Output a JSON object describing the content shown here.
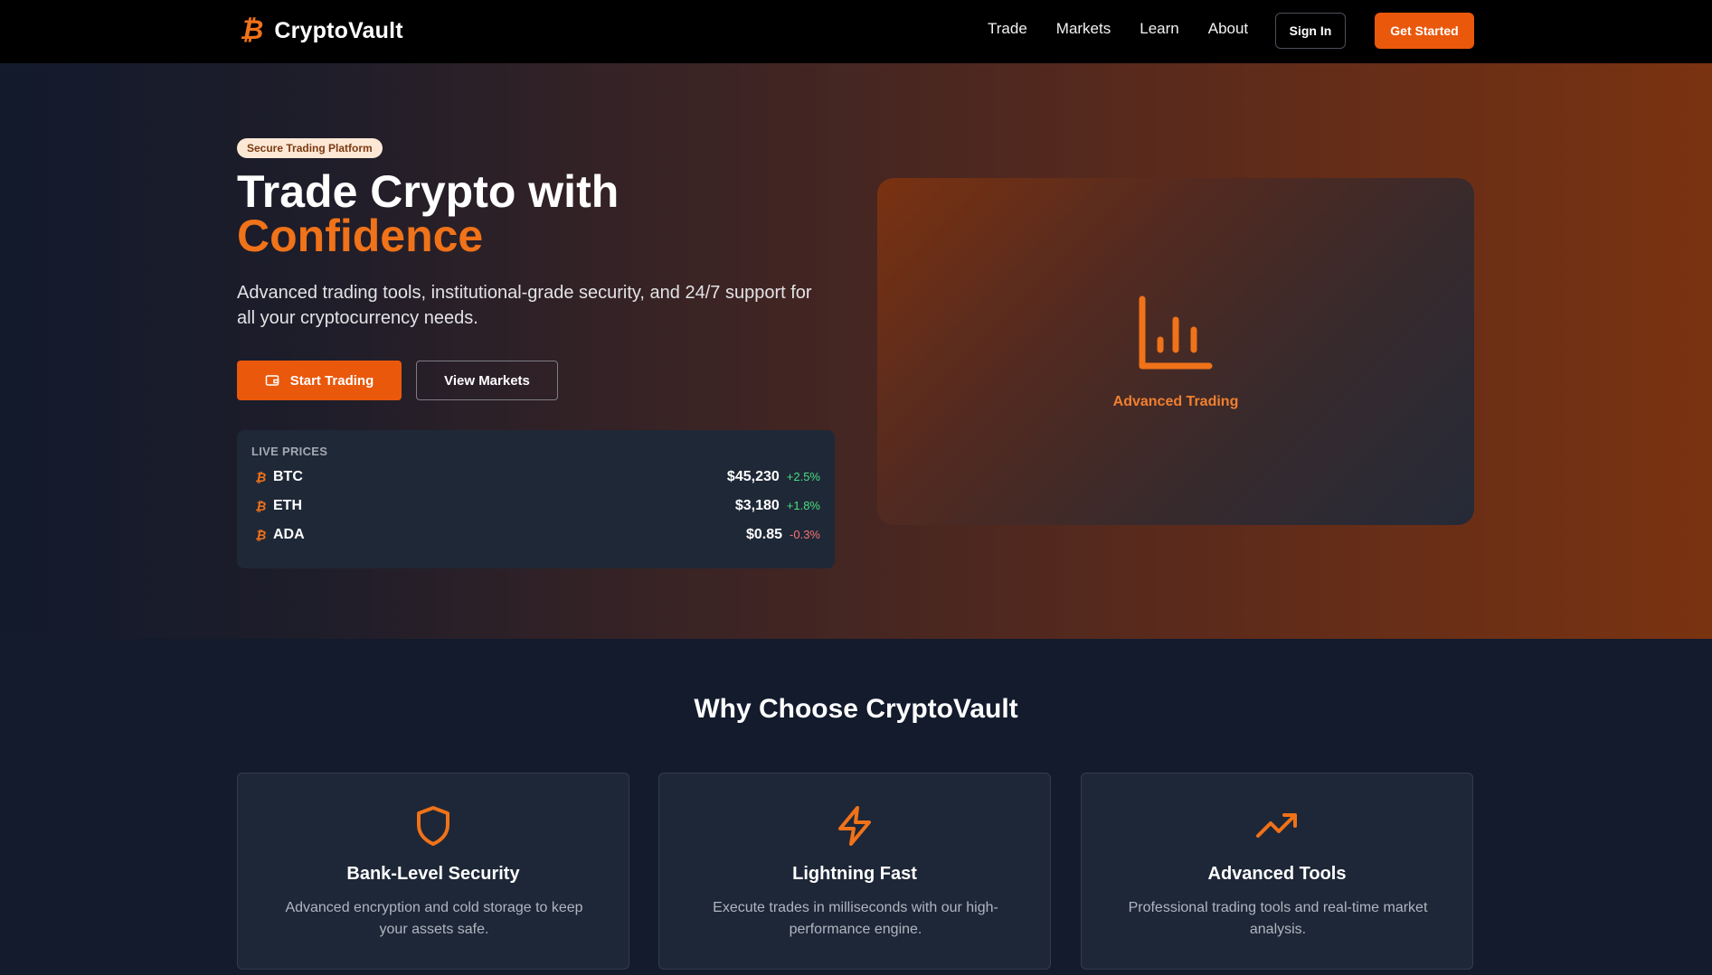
{
  "nav": {
    "brand_icon": "₿",
    "brand_name": "CryptoVault",
    "links": [
      "Trade",
      "Markets",
      "Learn",
      "About"
    ],
    "sign_in": "Sign In",
    "get_started": "Get Started"
  },
  "hero": {
    "badge": "Secure Trading Platform",
    "title_line1": "Trade Crypto with",
    "title_line2": "Confidence",
    "subtitle": "Advanced trading tools, institutional-grade security, and 24/7 support for all your cryptocurrency needs.",
    "start_trading": "Start Trading",
    "view_markets": "View Markets",
    "feature_label": "Advanced Trading",
    "feature_icon": "bar-chart-icon"
  },
  "prices": {
    "title": "LIVE PRICES",
    "coin_icon": "₿",
    "items": [
      {
        "symbol": "BTC",
        "price": "$45,230",
        "change": "+2.5%"
      },
      {
        "symbol": "ETH",
        "price": "$3,180",
        "change": "+1.8%"
      },
      {
        "symbol": "ADA",
        "price": "$0.85",
        "change": "-0.3%"
      }
    ]
  },
  "why": {
    "title": "Why Choose CryptoVault",
    "cards": [
      {
        "icon": "shield-icon",
        "title": "Bank-Level Security",
        "desc": "Advanced encryption and cold storage to keep your assets safe."
      },
      {
        "icon": "lightning-icon",
        "title": "Lightning Fast",
        "desc": "Execute trades in milliseconds with our high-performance engine."
      },
      {
        "icon": "trending-up-icon",
        "title": "Advanced Tools",
        "desc": "Professional trading tools and real-time market analysis."
      }
    ]
  },
  "colors": {
    "accent": "#ea580c",
    "accent_text": "#f07219",
    "positive": "#4ade80",
    "negative": "#f87171",
    "background": "#131b2d"
  }
}
